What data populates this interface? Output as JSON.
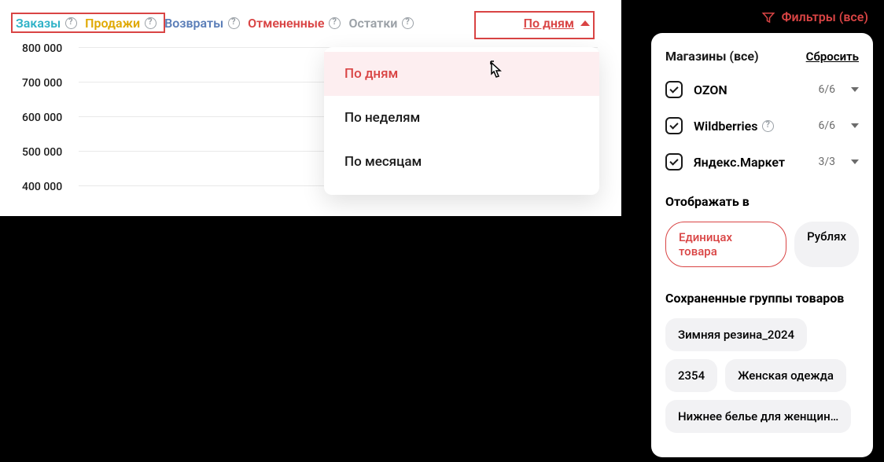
{
  "tabs": {
    "orders": "Заказы",
    "sales": "Продажи",
    "returns": "Возвраты",
    "cancelled": "Отмененные",
    "stock": "Остатки"
  },
  "period": {
    "button": "По дням",
    "options": [
      "По дням",
      "По неделям",
      "По месяцам"
    ]
  },
  "chart_data": {
    "type": "line",
    "title": "",
    "xlabel": "",
    "ylabel": "",
    "yticks": [
      "800 000",
      "700 000",
      "600 000",
      "500 000",
      "400 000"
    ],
    "ylim": [
      400000,
      800000
    ],
    "series": [],
    "categories": []
  },
  "filters": {
    "link": "Фильтры (все)",
    "stores_title": "Магазины (все)",
    "reset": "Сбросить",
    "stores": [
      {
        "name": "OZON",
        "count": "6/6"
      },
      {
        "name": "Wildberries",
        "count": "6/6"
      },
      {
        "name": "Яндекс.Маркет",
        "count": "3/3"
      }
    ],
    "display_in_title": "Отображать в",
    "display_options": {
      "units": "Единицах товара",
      "rubles": "Рублях"
    },
    "groups_title": "Сохраненные группы товаров",
    "groups": [
      "Зимняя резина_2024",
      "2354",
      "Женская одежда",
      "Нижнее белье для женщин…"
    ]
  }
}
